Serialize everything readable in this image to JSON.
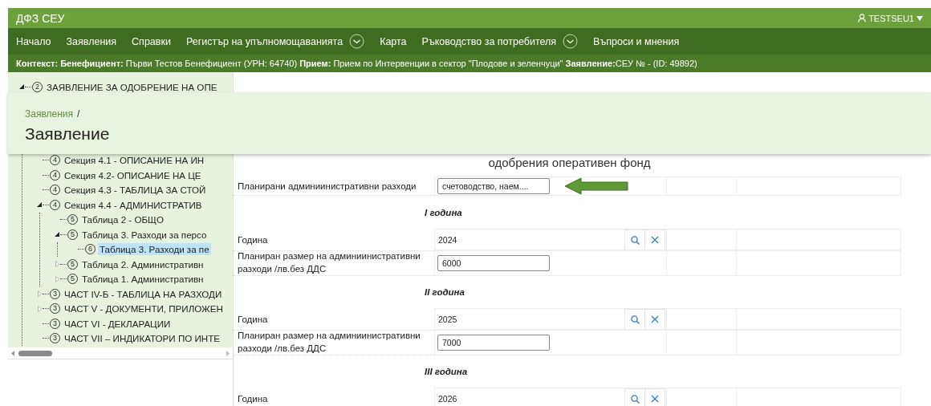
{
  "header": {
    "title": "ДФЗ СЕУ",
    "user": "TESTSEU1"
  },
  "nav": [
    {
      "label": "Начало",
      "kind": "link"
    },
    {
      "label": "Заявления",
      "kind": "link"
    },
    {
      "label": "Справки",
      "kind": "link"
    },
    {
      "label": "Регистър на упълномощаванията",
      "kind": "dropdown"
    },
    {
      "label": "Карта",
      "kind": "link"
    },
    {
      "label": "Ръководство за потребителя",
      "kind": "dropdown"
    },
    {
      "label": "Въпроси и мнения",
      "kind": "link"
    }
  ],
  "context": "**Контекст: Бенефициент:** Първи Тестов Бенефициент (УРН: 64740) **Прием:** Прием по Интервенции в сектор \"Плодове и зеленчуци\" **Заявление:**СЕУ № - (ID: 49892)",
  "breadcrumb": {
    "parent": "Заявления",
    "separator": "/",
    "title": "Заявление"
  },
  "tree": {
    "items": [
      {
        "number": "2",
        "label": "ЗАЯВЛЕНИЕ ЗА ОДОБРЕНИЕ НА ОПЕ",
        "kind": "branch",
        "expanded": true,
        "selected": false,
        "children": [
          {
            "kind": "group",
            "children": [
              {
                "number": "4",
                "label": "Секция 4.1 - ОПИСАНИЕ НА ИН",
                "kind": "leaf",
                "selected": false
              },
              {
                "number": "4",
                "label": "Секция 4.2- ОПИСАНИЕ НА ЦЕ",
                "kind": "leaf",
                "selected": false
              },
              {
                "number": "4",
                "label": "Секция 4.3 - ТАБЛИЦА ЗА СТОЙ",
                "kind": "leaf",
                "selected": false
              },
              {
                "number": "4",
                "label": "Секция 4.4 - АДМИНИСТРАТИВ",
                "kind": "branch",
                "expanded": true,
                "selected": false,
                "children": [
                  {
                    "number": "5",
                    "label": "Таблица 2 - ОБЩО",
                    "kind": "leaf",
                    "selected": false
                  },
                  {
                    "number": "5",
                    "label": "Таблица 3. Разходи за персо",
                    "kind": "branch",
                    "expanded": true,
                    "selected": false,
                    "children": [
                      {
                        "number": "6",
                        "label": "Таблица 3. Разходи за пе",
                        "kind": "leaf",
                        "selected": true
                      }
                    ]
                  },
                  {
                    "number": "5",
                    "label": "Таблица 2. Административн",
                    "kind": "branch",
                    "expanded": false,
                    "selected": false
                  },
                  {
                    "number": "5",
                    "label": "Таблица 1. Административн",
                    "kind": "branch",
                    "expanded": false,
                    "selected": false
                  }
                ]
              }
            ]
          },
          {
            "number": "3",
            "label": "ЧАСТ IV-Б - ТАБЛИЦА НА РАЗХОДИ",
            "kind": "branch",
            "expanded": false,
            "selected": false
          },
          {
            "number": "3",
            "label": "ЧАСТ V - ДОКУМЕНТИ, ПРИЛОЖЕН",
            "kind": "branch",
            "expanded": false,
            "selected": false
          },
          {
            "number": "3",
            "label": "ЧАСТ VI - ДЕКЛАРАЦИИ",
            "kind": "leaf",
            "selected": false
          },
          {
            "number": "3",
            "label": "ЧАСТ VII – ИНДИКАТОРИ ПО ИНТЕ",
            "kind": "leaf",
            "selected": false
          }
        ]
      }
    ]
  },
  "form": {
    "heading": "одобрения оперативен фонд",
    "rows": [
      {
        "kind": "text",
        "label": "Планирани админиинистративни разходи",
        "value": "счетоводство, наем....",
        "pointer": true
      },
      {
        "kind": "section",
        "title": "I година"
      },
      {
        "kind": "lookup",
        "label": "Година",
        "value": "2024"
      },
      {
        "kind": "number",
        "label": "Планиран размер на админиинистративни разходи /лв.без ДДС",
        "value": "6000"
      },
      {
        "kind": "section",
        "title": "II година"
      },
      {
        "kind": "lookup",
        "label": "Година",
        "value": "2025"
      },
      {
        "kind": "number",
        "label": "Планиран размер на админиинистративни разходи /лв.без ДДС",
        "value": "7000"
      },
      {
        "kind": "section",
        "title": "III година"
      },
      {
        "kind": "lookup",
        "label": "Година",
        "value": "2026"
      }
    ]
  }
}
